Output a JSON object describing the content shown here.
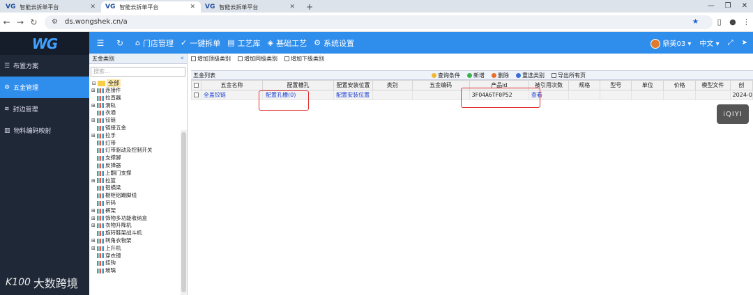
{
  "browser": {
    "tabs": [
      {
        "logo": "VG",
        "title": "智能云拆单平台",
        "active": false
      },
      {
        "logo": "VG",
        "title": "智能云拆单平台",
        "active": true
      },
      {
        "logo": "VG",
        "title": "智能云拆单平台",
        "active": false
      }
    ],
    "url": "ds.wongshek.cn/a"
  },
  "sidebar": {
    "brand": "WG",
    "items": [
      {
        "label": "布置方案",
        "active": false
      },
      {
        "label": "五金管理",
        "active": true
      },
      {
        "label": "封边管理",
        "active": false
      },
      {
        "label": "物料编码映射",
        "active": false
      }
    ]
  },
  "topbar": {
    "menus": [
      "门店管理",
      "一键拆单",
      "工艺库",
      "基础工艺",
      "系统设置"
    ],
    "user": "鼎美03",
    "language": "中文"
  },
  "tree": {
    "header": "五金类别",
    "search_placeholder": "搜索...",
    "root": "全部",
    "nodes": [
      {
        "label": "连接件",
        "expandable": true
      },
      {
        "label": "拉直器",
        "expandable": false
      },
      {
        "label": "滑轨",
        "expandable": true
      },
      {
        "label": "衣通",
        "expandable": false
      },
      {
        "label": "铰链",
        "expandable": true
      },
      {
        "label": "链接五金",
        "expandable": false
      },
      {
        "label": "拉手",
        "expandable": true
      },
      {
        "label": "灯带",
        "expandable": false
      },
      {
        "label": "灯带驱动及控制开关",
        "expandable": false
      },
      {
        "label": "支撑脚",
        "expandable": false
      },
      {
        "label": "反弹器",
        "expandable": false
      },
      {
        "label": "上翻门支撑",
        "expandable": false
      },
      {
        "label": "拉篮",
        "expandable": true
      },
      {
        "label": "铝横梁",
        "expandable": false
      },
      {
        "label": "橱柜铝踢脚线",
        "expandable": false
      },
      {
        "label": "吊码",
        "expandable": false
      },
      {
        "label": "裤架",
        "expandable": true
      },
      {
        "label": "饰物多功能收纳盒",
        "expandable": true
      },
      {
        "label": "衣物升降机",
        "expandable": true
      },
      {
        "label": "旋转鞋架战斗机",
        "expandable": false
      },
      {
        "label": "转角衣物架",
        "expandable": true
      },
      {
        "label": "上升机",
        "expandable": true
      },
      {
        "label": "穿衣镜",
        "expandable": false
      },
      {
        "label": "挂钩",
        "expandable": false
      },
      {
        "label": "玻璃",
        "expandable": false
      }
    ]
  },
  "main": {
    "toolbar": [
      "增加顶级类别",
      "增加同级类别",
      "增加下级类别"
    ],
    "list_title": "五金列表",
    "actions": [
      "查询条件",
      "新增",
      "删除",
      "重选类别",
      "导出所有页"
    ],
    "columns": [
      "五金名称",
      "配置槽孔",
      "配置安装位置",
      "类别",
      "五金编码",
      "产品id",
      "被引用次数",
      "规格",
      "型号",
      "单位",
      "价格",
      "模型文件",
      "创"
    ],
    "rows": [
      {
        "name": "全盖铰链",
        "slot": "配置孔槽(0)",
        "install": "配置安装位置",
        "category": "",
        "code": "",
        "product_id": "3FO4A6TF0P52",
        "ref": "查看",
        "spec": "",
        "model": "",
        "unit": "",
        "price": "",
        "file": "",
        "created": "2024-0"
      }
    ]
  },
  "overlay": {
    "iqiyi": "iQIYI",
    "watermark": "大数跨境",
    "watermark_logo": "K100"
  },
  "colors": {
    "primary": "#2f8dec",
    "sidebar": "#1f2837",
    "highlight": "#e23030"
  }
}
